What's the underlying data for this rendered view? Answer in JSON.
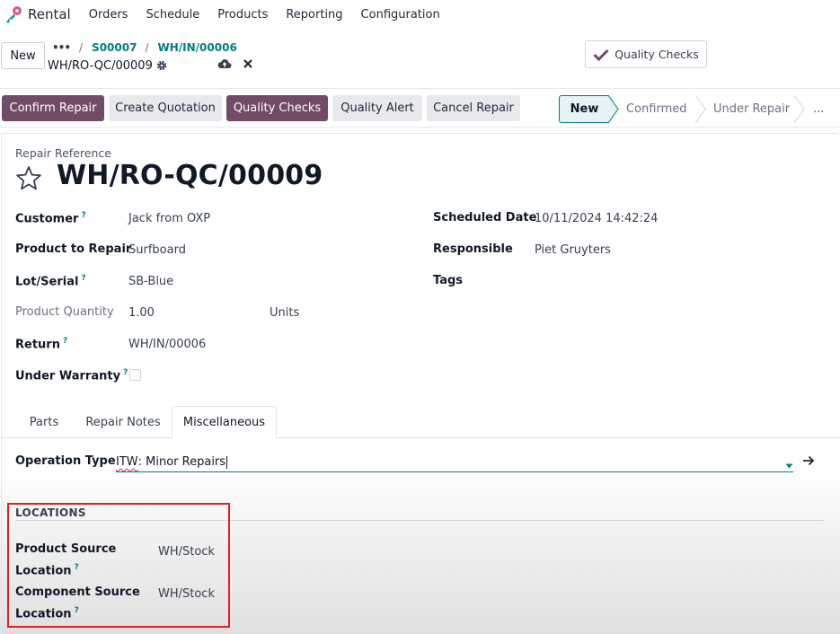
{
  "navbar": {
    "app_name": "Rental",
    "menu": [
      "Orders",
      "Schedule",
      "Products",
      "Reporting",
      "Configuration"
    ]
  },
  "control_panel": {
    "new_label": "New",
    "breadcrumbs": [
      "S00007",
      "WH/IN/00006"
    ],
    "record_name": "WH/RO-QC/00009",
    "quality_checks_label": "Quality Checks"
  },
  "statusbar": {
    "buttons": {
      "confirm": "Confirm Repair",
      "quotation": "Create Quotation",
      "quality_checks": "Quality Checks",
      "quality_alert": "Quality Alert",
      "cancel": "Cancel Repair"
    },
    "stages": [
      "New",
      "Confirmed",
      "Under Repair"
    ],
    "more_label": "..."
  },
  "form": {
    "reference_label": "Repair Reference",
    "reference": "WH/RO-QC/00009",
    "left": {
      "customer_label": "Customer",
      "customer": "Jack from OXP",
      "product_label": "Product to Repair",
      "product": "Surfboard",
      "lot_label": "Lot/Serial",
      "lot": "SB-Blue",
      "qty_label": "Product Quantity",
      "qty": "1.00",
      "uom": "Units",
      "return_label": "Return",
      "return": "WH/IN/00006",
      "warranty_label": "Under Warranty"
    },
    "right": {
      "date_label": "Scheduled Date",
      "date": "10/11/2024 14:42:24",
      "responsible_label": "Responsible",
      "responsible": "Piet Gruyters",
      "tags_label": "Tags"
    },
    "help_mark": "?"
  },
  "tabs": {
    "parts": "Parts",
    "notes": "Repair Notes",
    "misc": "Miscellaneous"
  },
  "misc": {
    "operation_type_label": "Operation Type",
    "operation_type_prefix": "ITW",
    "operation_type_rest": ": Minor Repairs",
    "locations_title": "LOCATIONS",
    "product_source_label_1": "Product Source",
    "product_source_label_2": "Location",
    "product_source": "WH/Stock",
    "component_source_label_1": "Component Source",
    "component_source_label_2": "Location",
    "component_source": "WH/Stock"
  },
  "colors": {
    "primary": "#714b67",
    "link": "#017e84",
    "highlight_box": "#e0201c"
  }
}
